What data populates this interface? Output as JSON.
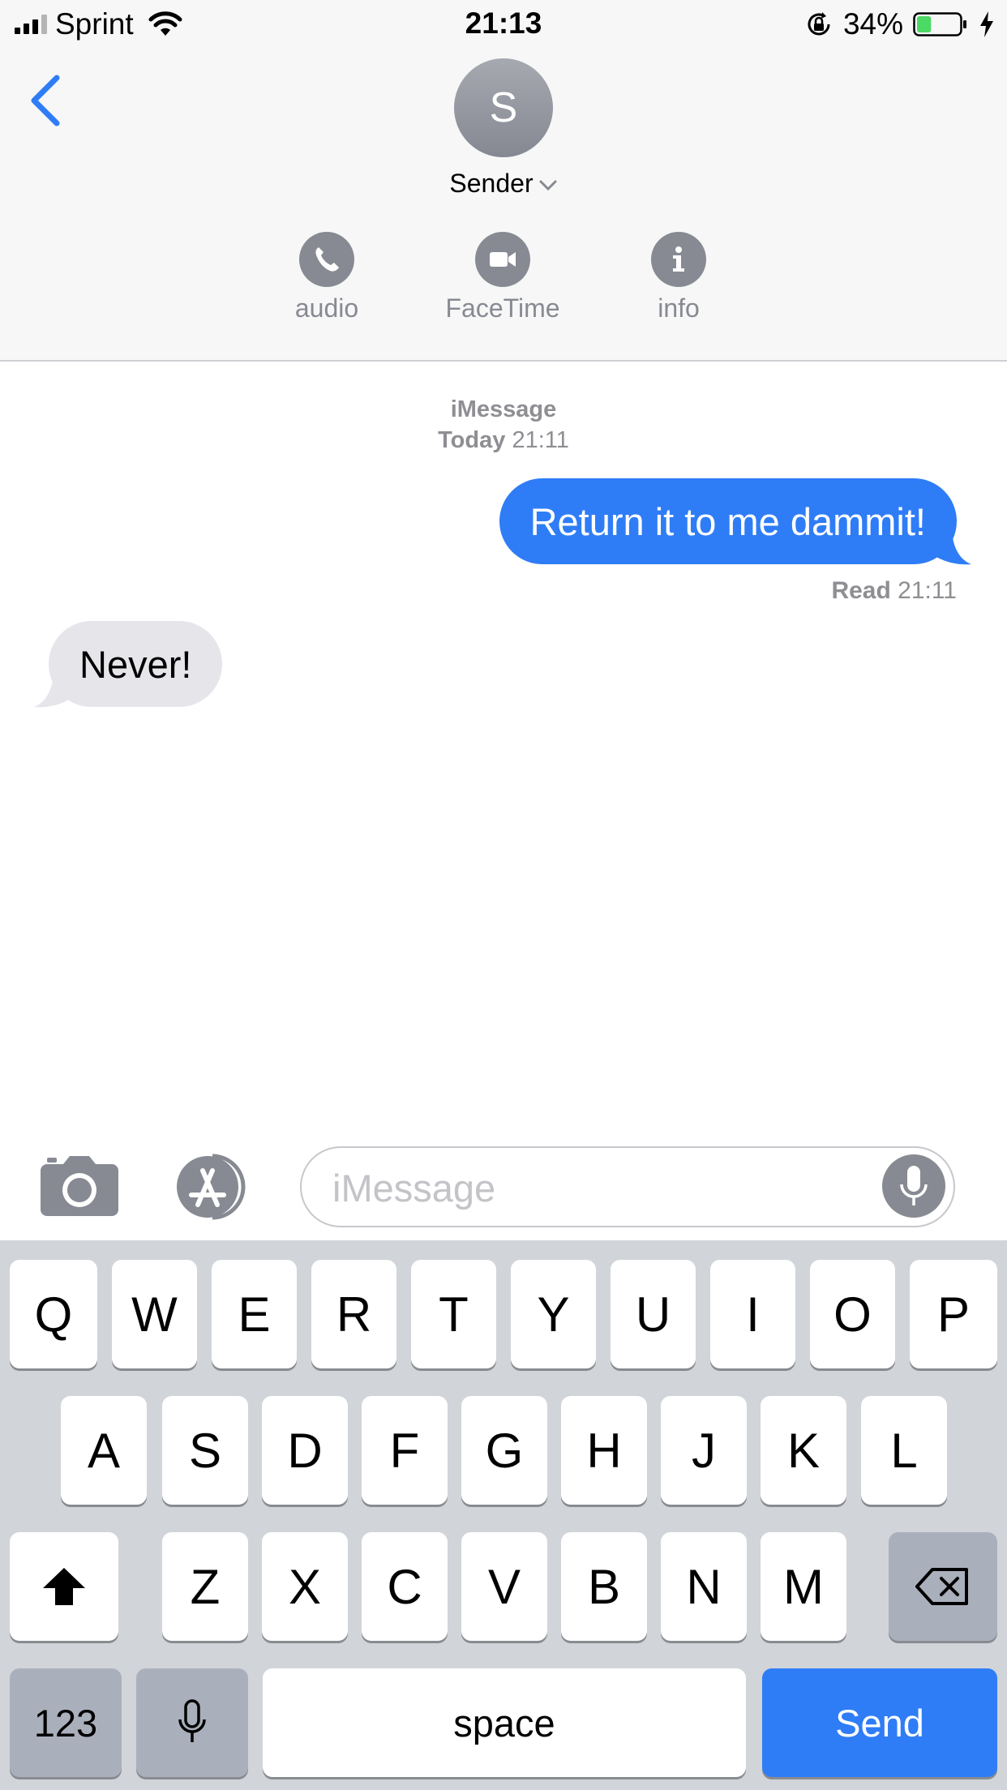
{
  "status_bar": {
    "carrier": "Sprint",
    "time": "21:13",
    "battery_percent": "34%",
    "battery_level": 0.34
  },
  "header": {
    "avatar_initial": "S",
    "contact_name": "Sender",
    "actions": [
      {
        "label": "audio",
        "icon": "phone-icon"
      },
      {
        "label": "FaceTime",
        "icon": "video-camera-icon"
      },
      {
        "label": "info",
        "icon": "info-icon"
      }
    ]
  },
  "conversation": {
    "service": "iMessage",
    "timestamp_day": "Today",
    "timestamp_time": "21:11",
    "messages": [
      {
        "direction": "outgoing",
        "text": "Return it to me dammit!"
      },
      {
        "direction": "incoming",
        "text": "Never!"
      }
    ],
    "read_label": "Read",
    "read_time": "21:11"
  },
  "input_bar": {
    "placeholder": "iMessage"
  },
  "keyboard": {
    "row1": [
      "Q",
      "W",
      "E",
      "R",
      "T",
      "Y",
      "U",
      "I",
      "O",
      "P"
    ],
    "row2": [
      "A",
      "S",
      "D",
      "F",
      "G",
      "H",
      "J",
      "K",
      "L"
    ],
    "row3": [
      "Z",
      "X",
      "C",
      "V",
      "B",
      "N",
      "M"
    ],
    "numbers_label": "123",
    "space_label": "space",
    "send_label": "Send"
  },
  "colors": {
    "accent": "#2f7df6",
    "incoming_bubble": "#e5e5ea",
    "icon_gray": "#878a92",
    "battery_fill": "#4cd964"
  }
}
